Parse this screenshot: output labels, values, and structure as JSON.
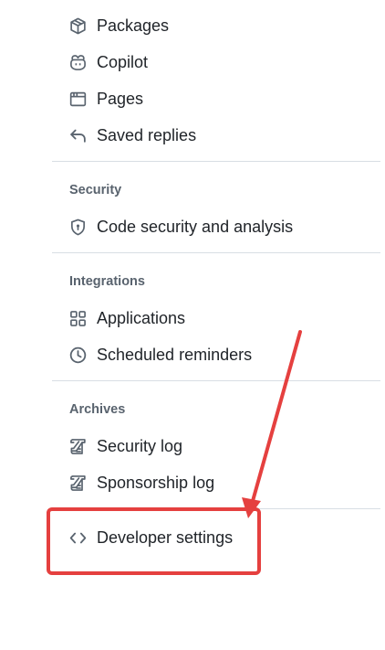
{
  "menu": {
    "items_top": [
      {
        "label": "Packages",
        "icon": "package-icon"
      },
      {
        "label": "Copilot",
        "icon": "copilot-icon"
      },
      {
        "label": "Pages",
        "icon": "browser-icon"
      },
      {
        "label": "Saved replies",
        "icon": "reply-icon"
      }
    ],
    "security": {
      "heading": "Security",
      "items": [
        {
          "label": "Code security and analysis",
          "icon": "shield-lock-icon"
        }
      ]
    },
    "integrations": {
      "heading": "Integrations",
      "items": [
        {
          "label": "Applications",
          "icon": "apps-icon"
        },
        {
          "label": "Scheduled reminders",
          "icon": "clock-icon"
        }
      ]
    },
    "archives": {
      "heading": "Archives",
      "items": [
        {
          "label": "Security log",
          "icon": "log-icon"
        },
        {
          "label": "Sponsorship log",
          "icon": "log-icon"
        }
      ]
    },
    "developer": {
      "label": "Developer settings",
      "icon": "code-icon"
    }
  },
  "annotation": {
    "color": "#e5403f",
    "highlight": "developer-settings"
  }
}
